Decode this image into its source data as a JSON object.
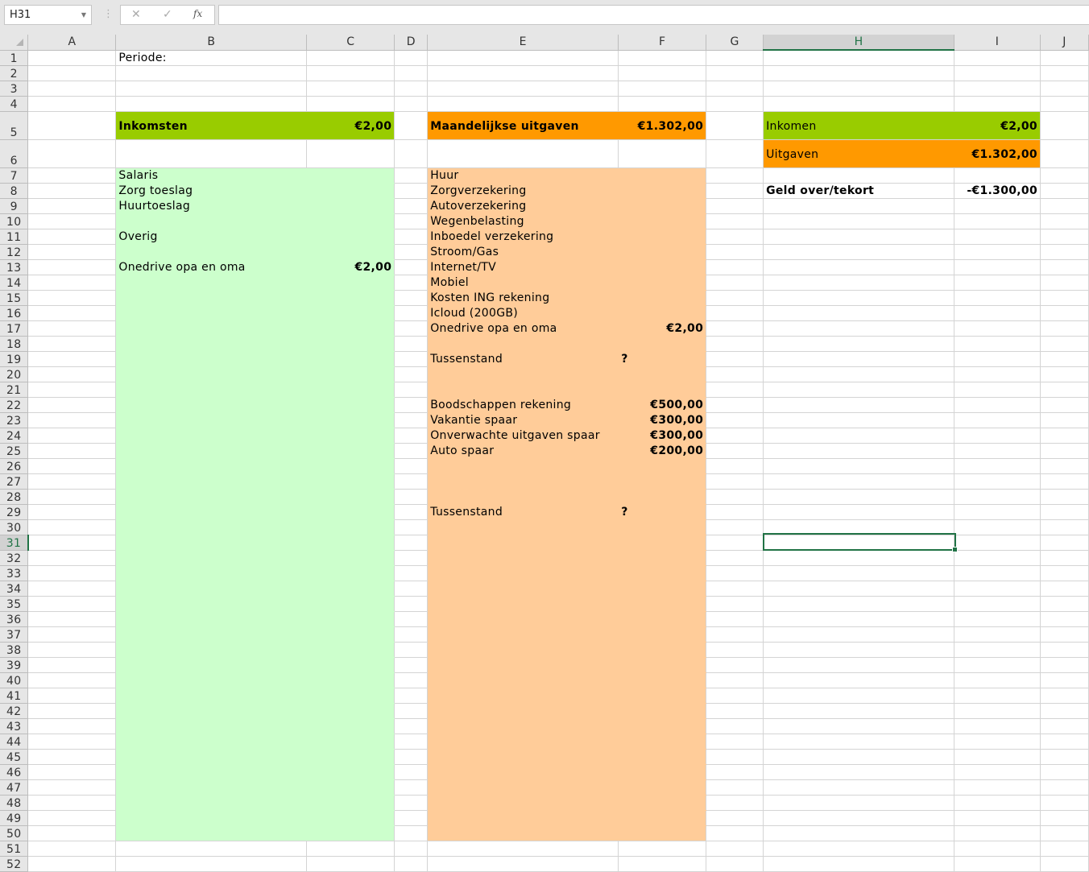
{
  "name_box": "H31",
  "formula_bar": {
    "value": "",
    "cancel_icon": "✕",
    "enter_icon": "✓",
    "fx_label": "fx"
  },
  "colors": {
    "green_header": "#99CC00",
    "green_fill": "#CCFFCC",
    "orange_header": "#FF9900",
    "orange_fill": "#FFCC99",
    "selection": "#217346"
  },
  "columns": [
    "A",
    "B",
    "C",
    "D",
    "E",
    "F",
    "G",
    "H",
    "I",
    "J"
  ],
  "rows": [
    "1",
    "2",
    "3",
    "4",
    "5",
    "6",
    "7",
    "8",
    "9",
    "10",
    "11",
    "12",
    "13",
    "14",
    "15",
    "16",
    "17",
    "18",
    "19",
    "20",
    "21",
    "22",
    "23",
    "24",
    "25",
    "26",
    "27",
    "28",
    "29",
    "30",
    "31",
    "32",
    "33",
    "34",
    "35",
    "36",
    "37",
    "38",
    "39",
    "40",
    "41",
    "42",
    "43",
    "44",
    "45",
    "46",
    "47",
    "48",
    "49",
    "50",
    "51",
    "52"
  ],
  "selected_cell": {
    "column": "H",
    "row": "31"
  },
  "cells": {
    "B1": {
      "text": "Periode:"
    },
    "B5": {
      "text": "Inkomsten",
      "bold": true
    },
    "C5": {
      "text": "€2,00",
      "bold": true,
      "num": true
    },
    "B7": {
      "text": "Salaris"
    },
    "B8": {
      "text": "Zorg toeslag"
    },
    "B9": {
      "text": "Huurtoeslag"
    },
    "B11": {
      "text": "Overig"
    },
    "B13": {
      "text": "Onedrive opa en oma"
    },
    "C13": {
      "text": "€2,00",
      "bold": true,
      "num": true
    },
    "E5": {
      "text": "Maandelijkse uitgaven",
      "bold": true
    },
    "F5": {
      "text": "€1.302,00",
      "bold": true,
      "num": true
    },
    "E7": {
      "text": "Huur"
    },
    "E8": {
      "text": "Zorgverzekering"
    },
    "E9": {
      "text": "Autoverzekering"
    },
    "E10": {
      "text": "Wegenbelasting"
    },
    "E11": {
      "text": "Inboedel verzekering"
    },
    "E12": {
      "text": "Stroom/Gas"
    },
    "E13": {
      "text": "Internet/TV"
    },
    "E14": {
      "text": "Mobiel"
    },
    "E15": {
      "text": "Kosten ING rekening"
    },
    "E16": {
      "text": "Icloud (200GB)"
    },
    "E17": {
      "text": "Onedrive opa en oma"
    },
    "F17": {
      "text": "€2,00",
      "bold": true,
      "num": true
    },
    "E19": {
      "text": "Tussenstand"
    },
    "F19": {
      "text": "?",
      "bold": true
    },
    "E22": {
      "text": "Boodschappen rekening"
    },
    "F22": {
      "text": "€500,00",
      "bold": true,
      "num": true
    },
    "E23": {
      "text": "Vakantie spaar"
    },
    "F23": {
      "text": "€300,00",
      "bold": true,
      "num": true
    },
    "E24": {
      "text": "Onverwachte uitgaven spaar"
    },
    "F24": {
      "text": "€300,00",
      "bold": true,
      "num": true
    },
    "E25": {
      "text": "Auto spaar"
    },
    "F25": {
      "text": "€200,00",
      "bold": true,
      "num": true
    },
    "E29": {
      "text": "Tussenstand"
    },
    "F29": {
      "text": "?",
      "bold": true
    },
    "H5": {
      "text": "Inkomen"
    },
    "I5": {
      "text": "€2,00",
      "bold": true,
      "num": true
    },
    "H6": {
      "text": "Uitgaven"
    },
    "I6": {
      "text": "€1.302,00",
      "bold": true,
      "num": true
    },
    "H8": {
      "text": "Geld over/tekort",
      "bold": true
    },
    "I8": {
      "text": "-€1.300,00",
      "bold": true,
      "num": true
    }
  }
}
